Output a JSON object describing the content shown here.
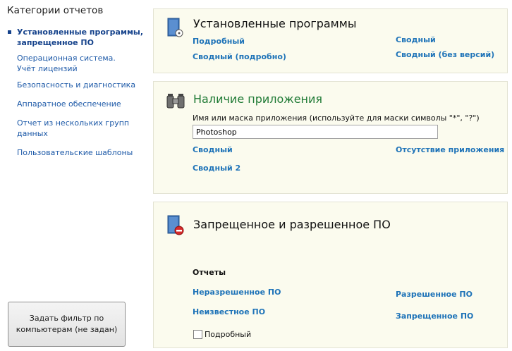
{
  "sidebar": {
    "title": "Категории отчетов",
    "items": [
      {
        "line1": "Установленные программы,",
        "line2": "запрещенное ПО"
      },
      {
        "line1": "Операционная система.",
        "line2": "Учёт лицензий"
      },
      {
        "line1": "Безопасность и диагностика",
        "line2": ""
      },
      {
        "line1": "Аппаратное обеспечение",
        "line2": ""
      },
      {
        "line1": "Отчет из нескольких групп",
        "line2": "данных"
      },
      {
        "line1": "Пользовательские шаблоны",
        "line2": ""
      }
    ],
    "filter_button": {
      "line1": "Задать фильтр по",
      "line2": "компьютерам (не задан)"
    }
  },
  "installed": {
    "title": "Установленные программы",
    "links": [
      "Подробный",
      "Сводный (подробно)",
      "Сводный",
      "Сводный (без версий)"
    ]
  },
  "availability": {
    "title": "Наличие приложения",
    "label": "Имя или маска приложения (используйте для маски символы \"*\", \"?\")",
    "input_value": "Photoshop",
    "links": [
      "Сводный",
      "Сводный 2",
      "Отсутствие приложения"
    ]
  },
  "forbidden": {
    "title": "Запрещенное и разрешенное ПО",
    "reports_label": "Отчеты",
    "links": [
      "Неразрешенное ПО",
      "Неизвестное ПО",
      "Разрешенное ПО",
      "Запрещенное ПО"
    ],
    "checkbox_label": "Подробный",
    "checkbox_checked": false
  },
  "colors": {
    "link": "#1e73b8",
    "sidebar_link": "#1e5aa8",
    "panel_bg": "#fbfbee",
    "green_title": "#1f7a35"
  }
}
